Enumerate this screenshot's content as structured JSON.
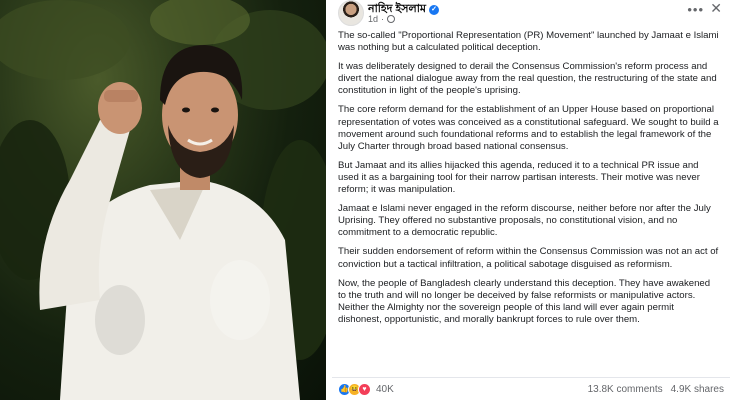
{
  "author": {
    "name": "নাহিদ ইসলাম",
    "time": "1d",
    "verified": true
  },
  "post": {
    "paragraphs": [
      "The so-called \"Proportional Representation (PR) Movement\" launched by Jamaat e Islami was nothing but a calculated political deception.",
      "It was deliberately designed to derail the Consensus Commission's reform process and divert the national dialogue away from the real question, the restructuring of the state and constitution in light of the people's uprising.",
      "The core reform demand for the establishment of an Upper House based on proportional representation of votes was conceived as a constitutional safeguard. We sought to build a movement around such foundational reforms and to establish the legal framework of the July Charter through broad based national consensus.",
      "But Jamaat and its allies hijacked this agenda, reduced it to a technical PR issue and used it as a bargaining tool for their narrow partisan interests. Their motive was never reform; it was manipulation.",
      "Jamaat e Islami never engaged in the reform discourse, neither before nor after the July Uprising. They offered no substantive proposals, no constitutional vision, and no commitment to a democratic republic.",
      "Their sudden endorsement of reform within the Consensus Commission was not an act of conviction but a tactical infiltration, a political sabotage disguised as reformism.",
      "Now, the people of Bangladesh clearly understand this deception. They have awakened to the truth and will no longer be deceived by false reformists or manipulative actors. Neither the Almighty nor the sovereign people of this land will ever again permit dishonest, opportunistic, and morally bankrupt forces to rule over them."
    ]
  },
  "footer": {
    "reactions_count": "40K",
    "comments": "13.8K comments",
    "shares": "4.9K shares"
  },
  "icons": [
    "more-icon",
    "close-icon",
    "verified-icon",
    "globe-icon",
    "like-icon",
    "haha-icon",
    "love-icon"
  ],
  "colors": {
    "accent": "#1877f2",
    "text": "#1c1e21",
    "muted": "#65676b"
  }
}
